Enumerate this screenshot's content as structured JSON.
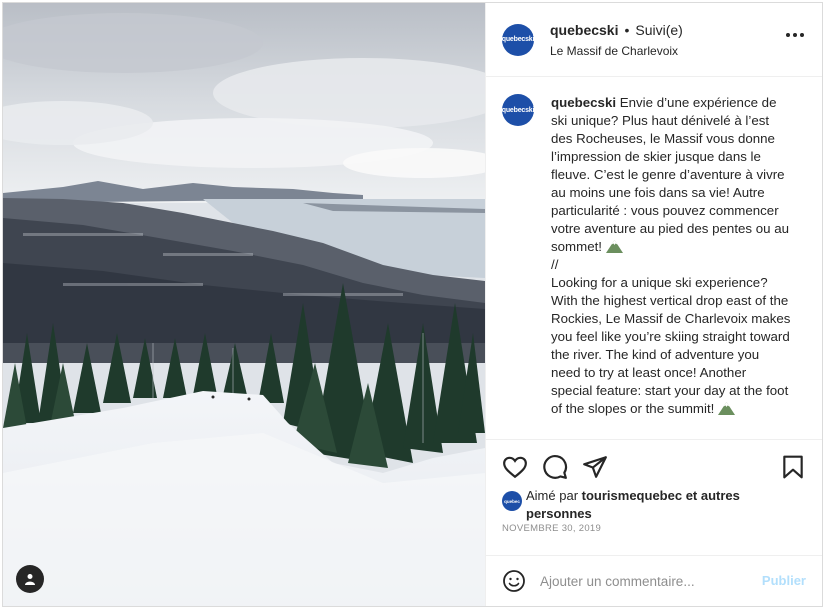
{
  "post": {
    "username": "quebecski",
    "separator": "•",
    "follow_status": "Suivi(e)",
    "location": "Le Massif de Charlevoix",
    "avatar_text": "quebecski",
    "caption_part1": "Envie d’une expérience de ski unique? Plus haut dénivelé à l’est des Rocheuses, le Massif vous donne l’impression de skier jusque dans le fleuve. C’est le genre d’aventure à vivre au moins une fois dans sa vie! Autre particularité : vous pouvez commencer votre aventure au pied des pentes ou au sommet!",
    "caption_part2": "//\nLooking for a unique ski experience? With the highest vertical drop east of the Rockies, Le Massif de Charlevoix makes you feel like you’re skiing straight toward the river. The kind of adventure you need to try at least once! Another special feature: start your day at the foot of the slopes or the summit!",
    "likes_prefix": "Aimé par",
    "likes_user": "tourismequebec",
    "likes_suffix": "et autres personnes",
    "liker_avatar_text": "quebec",
    "date": "NOVEMBRE 30, 2019"
  },
  "comment": {
    "placeholder": "Ajouter un commentaire...",
    "publish_label": "Publier"
  },
  "colors": {
    "brand_blue": "#1d4fa8",
    "publish_disabled": "#b2dffc",
    "secondary_text": "#8e8e8e"
  },
  "icons": [
    "heart-icon",
    "comment-icon",
    "share-icon",
    "bookmark-icon",
    "more-icon",
    "emoji-icon",
    "user-tag-icon",
    "mountain-emoji-icon"
  ]
}
